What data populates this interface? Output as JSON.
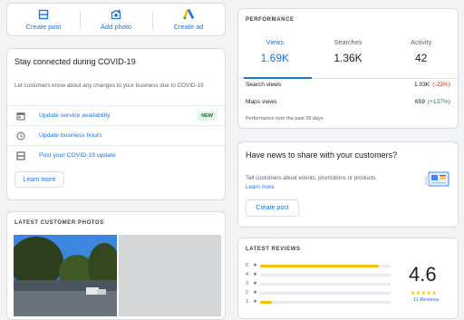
{
  "actions": [
    {
      "label": "Create post",
      "icon": "post-icon"
    },
    {
      "label": "Add photo",
      "icon": "camera-icon"
    },
    {
      "label": "Create ad",
      "icon": "google-ads-icon"
    }
  ],
  "covid": {
    "title": "Stay connected during COVID-19",
    "description": "Let customers know about any changes to your business due to COVID-19",
    "items": [
      {
        "label": "Update service availability",
        "icon": "calendar-icon",
        "badge": "NEW"
      },
      {
        "label": "Update business hours",
        "icon": "clock-icon",
        "badge": ""
      },
      {
        "label": "Post your COVID-19 update",
        "icon": "post-icon",
        "badge": ""
      }
    ],
    "learn_more": "Learn more"
  },
  "photos": {
    "heading": "LATEST CUSTOMER PHOTOS"
  },
  "performance": {
    "heading": "PERFORMANCE",
    "tabs": [
      {
        "label": "Views",
        "value": "1.69K",
        "active": true
      },
      {
        "label": "Searches",
        "value": "1.36K",
        "active": false
      },
      {
        "label": "Activity",
        "value": "42",
        "active": false
      }
    ],
    "stats": [
      {
        "label": "Search views",
        "value": "1.03K",
        "delta": "(-23%)",
        "delta_color": "#d93025"
      },
      {
        "label": "Maps views",
        "value": "659",
        "delta": "(+137%)",
        "delta_color": "#188038"
      }
    ],
    "footnote": "Performance over the past 28 days"
  },
  "news": {
    "title": "Have news to share with your customers?",
    "description": "Tell customers about events, promotions or products.",
    "learn_more": "Learn more",
    "button": "Create post"
  },
  "reviews": {
    "heading": "LATEST REVIEWS",
    "score": "4.6",
    "stars": "★★★★★",
    "count": "11 Reviews",
    "distribution": [
      {
        "stars": "5",
        "fraction": 0.91
      },
      {
        "stars": "4",
        "fraction": 0
      },
      {
        "stars": "3",
        "fraction": 0
      },
      {
        "stars": "2",
        "fraction": 0
      },
      {
        "stars": "1",
        "fraction": 0.09
      }
    ],
    "bar_color": "#fbbc04"
  },
  "colors": {
    "accent": "#1a73e8"
  }
}
